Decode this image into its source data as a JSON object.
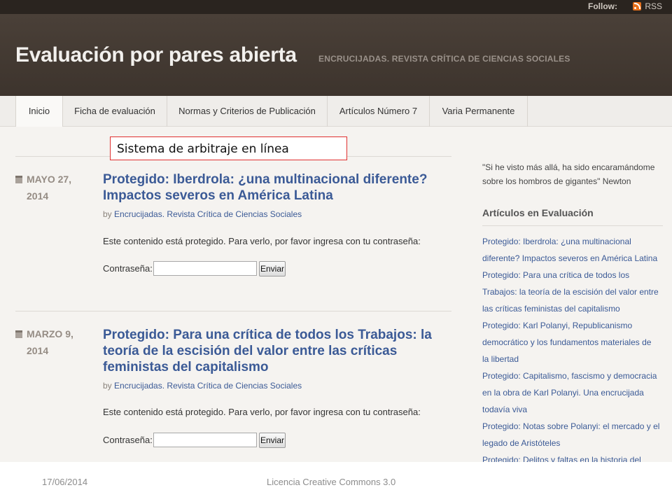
{
  "topbar": {
    "follow_label": "Follow:",
    "rss_label": "RSS",
    "rss_icon": "rss-feed-icon"
  },
  "header": {
    "title": "Evaluación por pares abierta",
    "description": "ENCRUCIJADAS. REVISTA CRÍTICA DE CIENCIAS SOCIALES"
  },
  "nav": {
    "items": [
      {
        "label": "Inicio",
        "active": true
      },
      {
        "label": "Ficha de evaluación"
      },
      {
        "label": "Normas y Criterios de Publicación"
      },
      {
        "label": "Artículos Número 7"
      },
      {
        "label": "Varia Permanente"
      }
    ]
  },
  "annotation": {
    "text": "Sistema de arbitraje en línea"
  },
  "posts": [
    {
      "date_line1": "MAYO 27,",
      "date_line2": "2014",
      "title_line1": "Protegido: Iberdrola: ¿una multinacional diferente?",
      "title_line2": "Impactos severos en América Latina",
      "by": "by",
      "author": "Encrucijadas. Revista Crítica de Ciencias Sociales",
      "protected_text": "Este contenido está protegido. Para verlo, por favor ingresa con tu contraseña:",
      "password_label": "Contraseña:",
      "password_value": "",
      "submit_label": "Enviar"
    },
    {
      "date_line1": "MARZO 9,",
      "date_line2": "2014",
      "title_line1": "Protegido: Para una crítica de todos los Trabajos: la",
      "title_line2": "teoría de la escisión del valor entre las críticas",
      "title_line3": "feministas del capitalismo",
      "by": "by",
      "author": "Encrucijadas. Revista Crítica de Ciencias Sociales",
      "protected_text": "Este contenido está protegido. Para verlo, por favor ingresa con tu contraseña:",
      "password_label": "Contraseña:",
      "password_value": "",
      "submit_label": "Enviar"
    }
  ],
  "sidebar": {
    "quote_line1": "\"Si he visto más allá, ha sido encaramándome",
    "quote_line2": "sobre los hombros de gigantes\" Newton",
    "heading": "Artículos en Evaluación",
    "items": [
      {
        "lines": [
          "Protegido: Iberdrola: ¿una multinacional",
          "diferente? Impactos severos en América Latina"
        ]
      },
      {
        "lines": [
          "Protegido: Para una crítica de todos los",
          "Trabajos: la teoría de la escisión del valor entre",
          "las críticas feministas del capitalismo"
        ]
      },
      {
        "lines": [
          "Protegido: Karl Polanyi, Republicanismo",
          "democrático y los fundamentos materiales de",
          "la libertad"
        ]
      },
      {
        "lines": [
          "Protegido: Capitalismo, fascismo y democracia",
          "en la obra de Karl Polanyi. Una encrucijada",
          "todavía viva"
        ]
      },
      {
        "lines": [
          "Protegido: Notas sobre Polanyi: el mercado y el",
          "legado de Aristóteles"
        ]
      },
      {
        "lines": [
          "Protegido: Delitos y faltas en la historia del"
        ]
      }
    ]
  },
  "footer": {
    "date": "17/06/2014",
    "license": "Licencia Creative Commons 3.0"
  },
  "colors": {
    "header_bg": "#3d342d",
    "link": "#3b5a96",
    "annotation_border": "#e03030"
  }
}
